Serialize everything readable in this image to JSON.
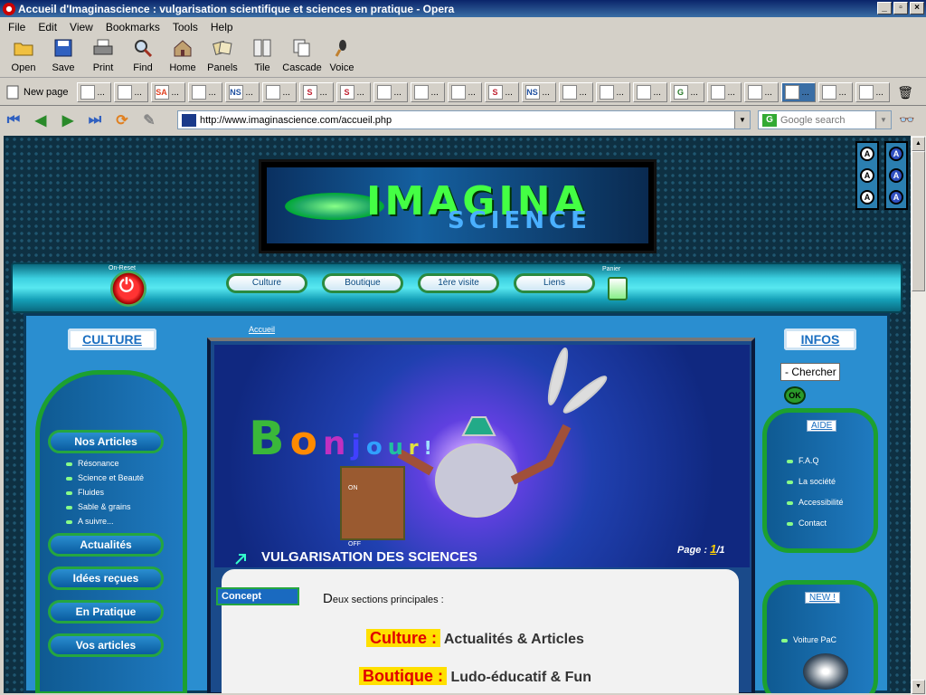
{
  "window": {
    "title": "Accueil d'Imaginascience : vulgarisation scientifique et sciences en pratique - Opera"
  },
  "menu": [
    "File",
    "Edit",
    "View",
    "Bookmarks",
    "Tools",
    "Help"
  ],
  "toolbar": [
    "Open",
    "Save",
    "Print",
    "Find",
    "Home",
    "Panels",
    "Tile",
    "Cascade",
    "Voice"
  ],
  "tabs": {
    "new_page": "New page",
    "tab_icons": [
      "page",
      "page",
      "SA",
      "page",
      "NS",
      "page",
      "S",
      "S",
      "page",
      "page",
      "page",
      "S",
      "NS",
      "page",
      "page",
      "page",
      "G",
      "page",
      "page",
      "active",
      "page",
      "page"
    ]
  },
  "address": {
    "url": "http://www.imaginascience.com/accueil.php",
    "search_placeholder": "Google search"
  },
  "site": {
    "banner_title": "IMAGINA",
    "banner_sub": "SCIENCE",
    "power_label": "On-Reset",
    "cart_label": "Panier",
    "nav": [
      "Culture",
      "Boutique",
      "1ère visite",
      "Liens"
    ],
    "left_header": "CULTURE",
    "right_header": "INFOS",
    "breadcrumb": "Accueil",
    "menu_items": [
      "Nos Articles",
      "Actualités",
      "Idées reçues",
      "En Pratique",
      "Vos articles"
    ],
    "sub_items": [
      "Résonance",
      "Science et Beauté",
      "Fluides",
      "Sable & grains",
      "A suivre..."
    ],
    "hero_word": "Bonjour!",
    "hero_caption": "VULGARISATION DES SCIENCES",
    "page_label": "Page :",
    "page_current": "1",
    "page_total": "/1",
    "concept": "Concept",
    "intro_first": "D",
    "intro_rest": "eux sections principales :",
    "line1_hl": "Culture :",
    "line1_text": "Actualités & Articles",
    "line2_hl": "Boutique :",
    "line2_text": "Ludo-éducatif & Fun",
    "search_text": "- Chercher",
    "ok": "OK",
    "aide_title": "AIDE",
    "aide_items": [
      "F.A.Q",
      "La société",
      "Accessibilité",
      "Contact"
    ],
    "new_title": "NEW !",
    "new_items": [
      "Voiture PaC"
    ],
    "on_label": "ON",
    "off_label": "OFF",
    "font_buttons": [
      "A",
      "A",
      "A",
      "A",
      "A",
      "A"
    ]
  },
  "colors": {
    "title_bar": "#0a246a",
    "site_bg": "#0e3042",
    "panel_blue": "#2a8ed0",
    "green_border": "#1ca030",
    "highlight": "#ffe000"
  }
}
